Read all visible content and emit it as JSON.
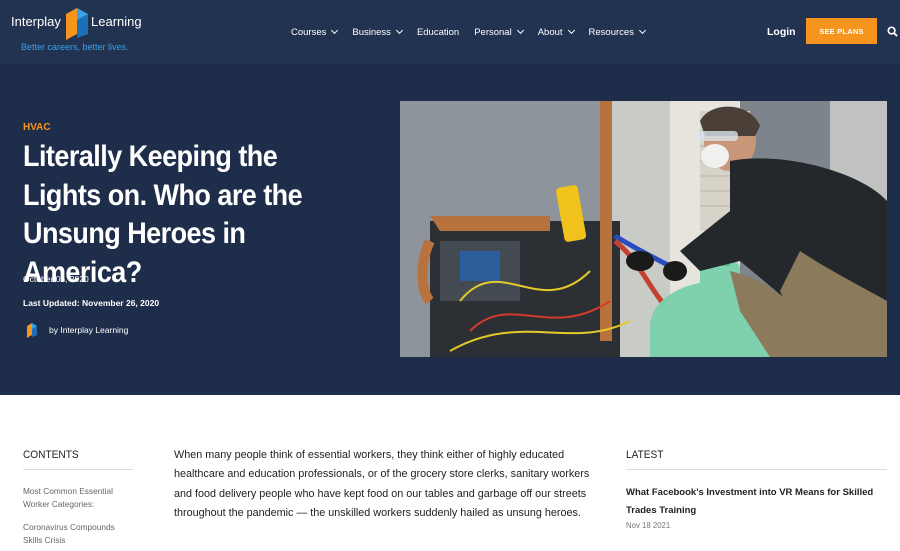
{
  "brand": {
    "name_part1": "Interplay",
    "name_part2": "Learning",
    "tagline": "Better careers, better lives.",
    "colors": {
      "navy": "#223352",
      "hero_navy": "#1e2d4a",
      "orange": "#f7941d",
      "logo_blue": "#3aa0e8",
      "logo_orange": "#f7941d"
    }
  },
  "nav": {
    "items": [
      {
        "label": "Courses",
        "has_dropdown": true
      },
      {
        "label": "Business",
        "has_dropdown": true
      },
      {
        "label": "Education",
        "has_dropdown": false
      },
      {
        "label": "Personal",
        "has_dropdown": true
      },
      {
        "label": "About",
        "has_dropdown": true
      },
      {
        "label": "Resources",
        "has_dropdown": true
      }
    ],
    "login_label": "Login",
    "cta_label": "SEE PLANS",
    "search_icon": "search-icon"
  },
  "hero": {
    "category": "HVAC",
    "title": "Literally Keeping the Lights on. Who are the Unsung Heroes in America?",
    "date": "October 06, 2020",
    "last_updated": "Last Updated: November 26, 2020",
    "author": "by Interplay Learning",
    "image_icon": "hvac-technician-photo"
  },
  "contents": {
    "heading": "CONTENTS",
    "items": [
      "Most Common Essential Worker Categories:",
      "Coronavirus Compounds Skills Crisis"
    ]
  },
  "article": {
    "intro": "When many people think of essential workers, they think either of highly educated healthcare and education professionals, or of the grocery store clerks, sanitary workers and food delivery people who have kept food on our tables and garbage off our streets throughout the pandemic — the unskilled workers suddenly hailed as unsung heroes."
  },
  "latest": {
    "heading": "LATEST",
    "posts": [
      {
        "title": "What Facebook's Investment into VR Means for Skilled Trades Training",
        "date": "Nov 18 2021"
      }
    ]
  }
}
